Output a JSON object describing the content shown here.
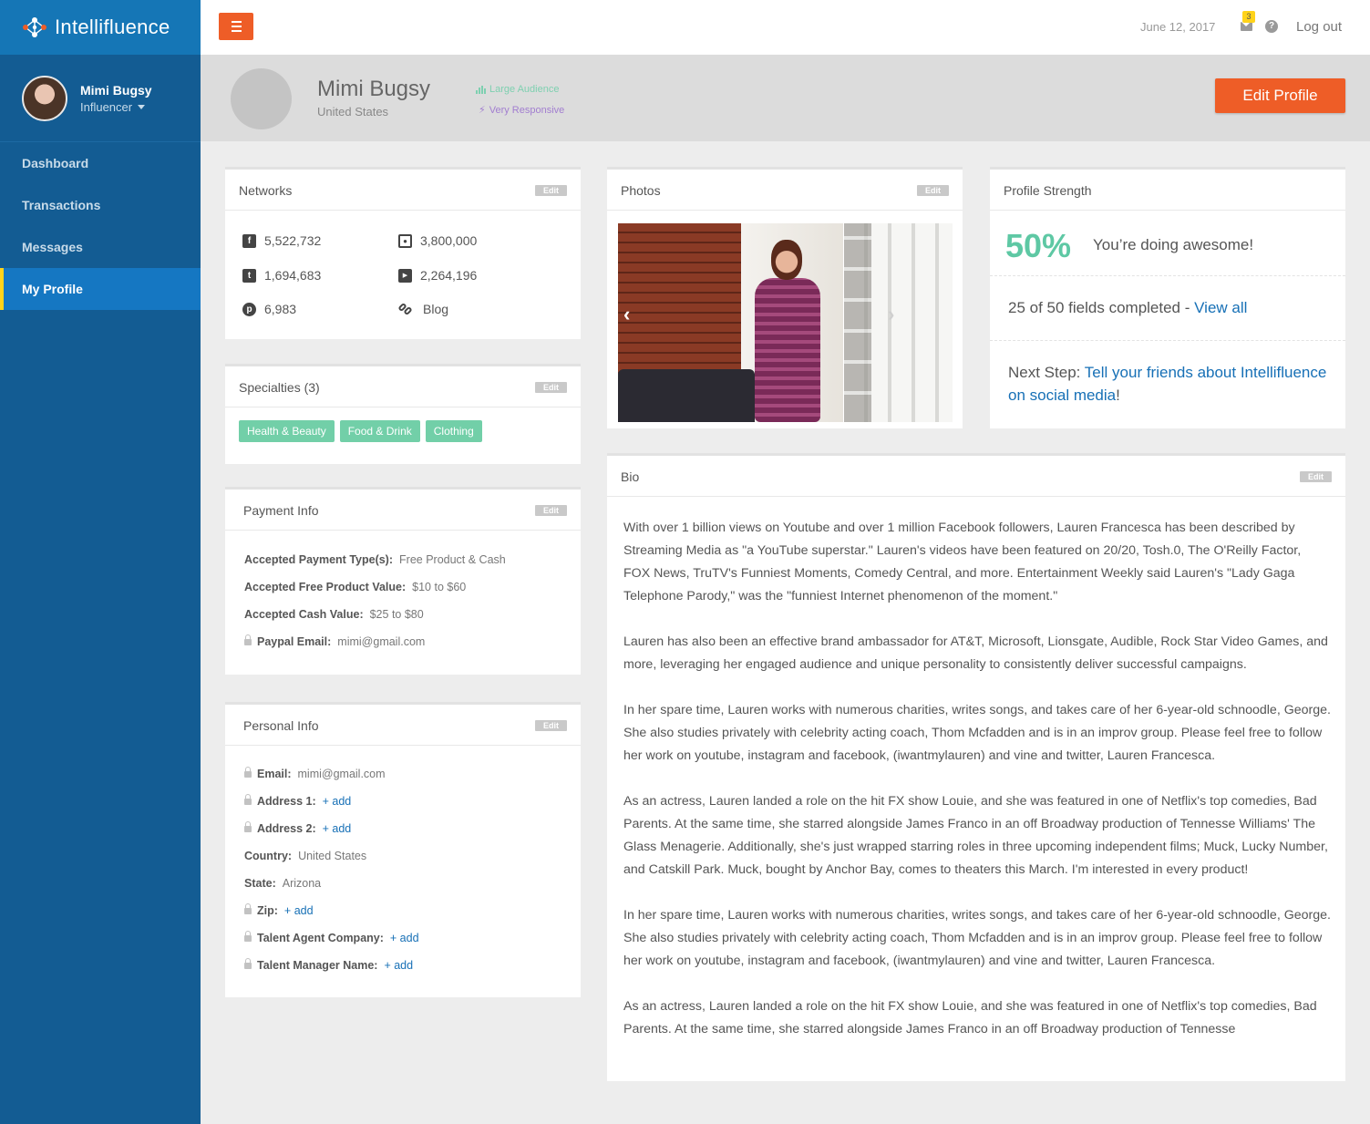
{
  "brand": {
    "name_bold": "Intelli",
    "name_thin": "fluence"
  },
  "user": {
    "name": "Mimi Bugsy",
    "role": "Influencer"
  },
  "nav": [
    {
      "label": "Dashboard"
    },
    {
      "label": "Transactions"
    },
    {
      "label": "Messages"
    },
    {
      "label": "My Profile"
    }
  ],
  "topbar": {
    "date": "June 12, 2017",
    "notifications": "3",
    "help": "?",
    "logout": "Log out"
  },
  "profile": {
    "name": "Mimi Bugsy",
    "country": "United States",
    "tag_audience": "Large Audience",
    "tag_response": "Very Responsive",
    "edit_button": "Edit Profile"
  },
  "edit_label": "Edit",
  "networks": {
    "title": "Networks",
    "facebook": "5,522,732",
    "instagram": "3,800,000",
    "twitter": "1,694,683",
    "youtube": "2,264,196",
    "pinterest": "6,983",
    "blog": "Blog"
  },
  "specialties": {
    "title": "Specialties (3)",
    "tags": [
      "Health & Beauty",
      "Food & Drink",
      "Clothing"
    ]
  },
  "payment": {
    "title": "Payment Info",
    "rows": [
      {
        "label": "Accepted Payment Type(s):",
        "value": "Free Product & Cash"
      },
      {
        "label": "Accepted Free Product Value:",
        "value": "$10 to $60"
      },
      {
        "label": "Accepted Cash Value:",
        "value": "$25 to $80"
      },
      {
        "label": "Paypal Email:",
        "value": "mimi@gmail.com"
      }
    ]
  },
  "personal": {
    "title": "Personal Info",
    "rows": [
      {
        "label": "Email:",
        "value": "mimi@gmail.com"
      },
      {
        "label": "Address 1:",
        "value": "+ add"
      },
      {
        "label": "Address 2:",
        "value": "+ add"
      },
      {
        "label": "Country:",
        "value": "United States"
      },
      {
        "label": "State:",
        "value": "Arizona"
      },
      {
        "label": "Zip:",
        "value": "+ add"
      },
      {
        "label": "Talent Agent Company:",
        "value": "+ add"
      },
      {
        "label": "Talent Manager Name:",
        "value": "+ add"
      }
    ]
  },
  "photos": {
    "title": "Photos",
    "prev": "‹",
    "next": "›"
  },
  "strength": {
    "title": "Profile Strength",
    "percent": "50%",
    "message": "You’re doing awesome!",
    "fields": "25 of 50 fields completed -",
    "view_all": "View all",
    "next_label": "Next Step:",
    "next_link": "Tell your friends about Intellifluence on social media",
    "next_end": "!"
  },
  "bio": {
    "title": "Bio",
    "paragraphs": [
      "With over 1 billion views on Youtube and over 1 million Facebook followers, Lauren Francesca has been described by Streaming Media as \"a YouTube superstar.\" Lauren's videos have been featured on 20/20, Tosh.0, The O'Reilly Factor, FOX News, TruTV's Funniest Moments, Comedy Central, and more. Entertainment Weekly said Lauren's \"Lady Gaga Telephone Parody,\" was the \"funniest Internet phenomenon of the moment.\"",
      "Lauren has also been an effective brand ambassador for AT&T, Microsoft, Lionsgate, Audible, Rock Star Video Games, and more, leveraging her engaged audience and unique personality to consistently deliver successful campaigns.",
      "In her spare time, Lauren works with numerous charities, writes songs, and takes care of her 6-year-old schnoodle, George. She also studies privately with celebrity acting coach, Thom Mcfadden and is in an improv group. Please feel free to follow her work on youtube, instagram and facebook, (iwantmylauren) and vine and twitter, Lauren Francesca.",
      "As an actress, Lauren landed a role on the hit FX show Louie, and she was featured in one of Netflix's top comedies, Bad Parents. At the same time, she starred alongside James Franco in an off Broadway production of Tennesse Williams' The Glass Menagerie. Additionally, she's just wrapped starring roles in three upcoming independent films; Muck, Lucky Number, and Catskill Park. Muck, bought by Anchor Bay, comes to theaters this March. I'm interested in every product!",
      "In her spare time, Lauren works with numerous charities, writes songs, and takes care of her 6-year-old schnoodle, George. She also studies privately with celebrity acting coach, Thom Mcfadden and is in an improv group. Please feel free to follow her work on youtube, instagram and facebook, (iwantmylauren) and vine and twitter, Lauren Francesca.",
      "As an actress, Lauren landed a role on the hit FX show Louie, and she was featured in one of Netflix's top comedies, Bad Parents. At the same time, she starred alongside James Franco in an off Broadway production of Tennesse"
    ]
  },
  "colors": {
    "sidebar": "#135c93",
    "brand_bar": "#1576b6",
    "accent": "#ee5d27",
    "active_marker": "#ffd31a",
    "tag_green": "#72cfa8",
    "link": "#1770b6"
  }
}
